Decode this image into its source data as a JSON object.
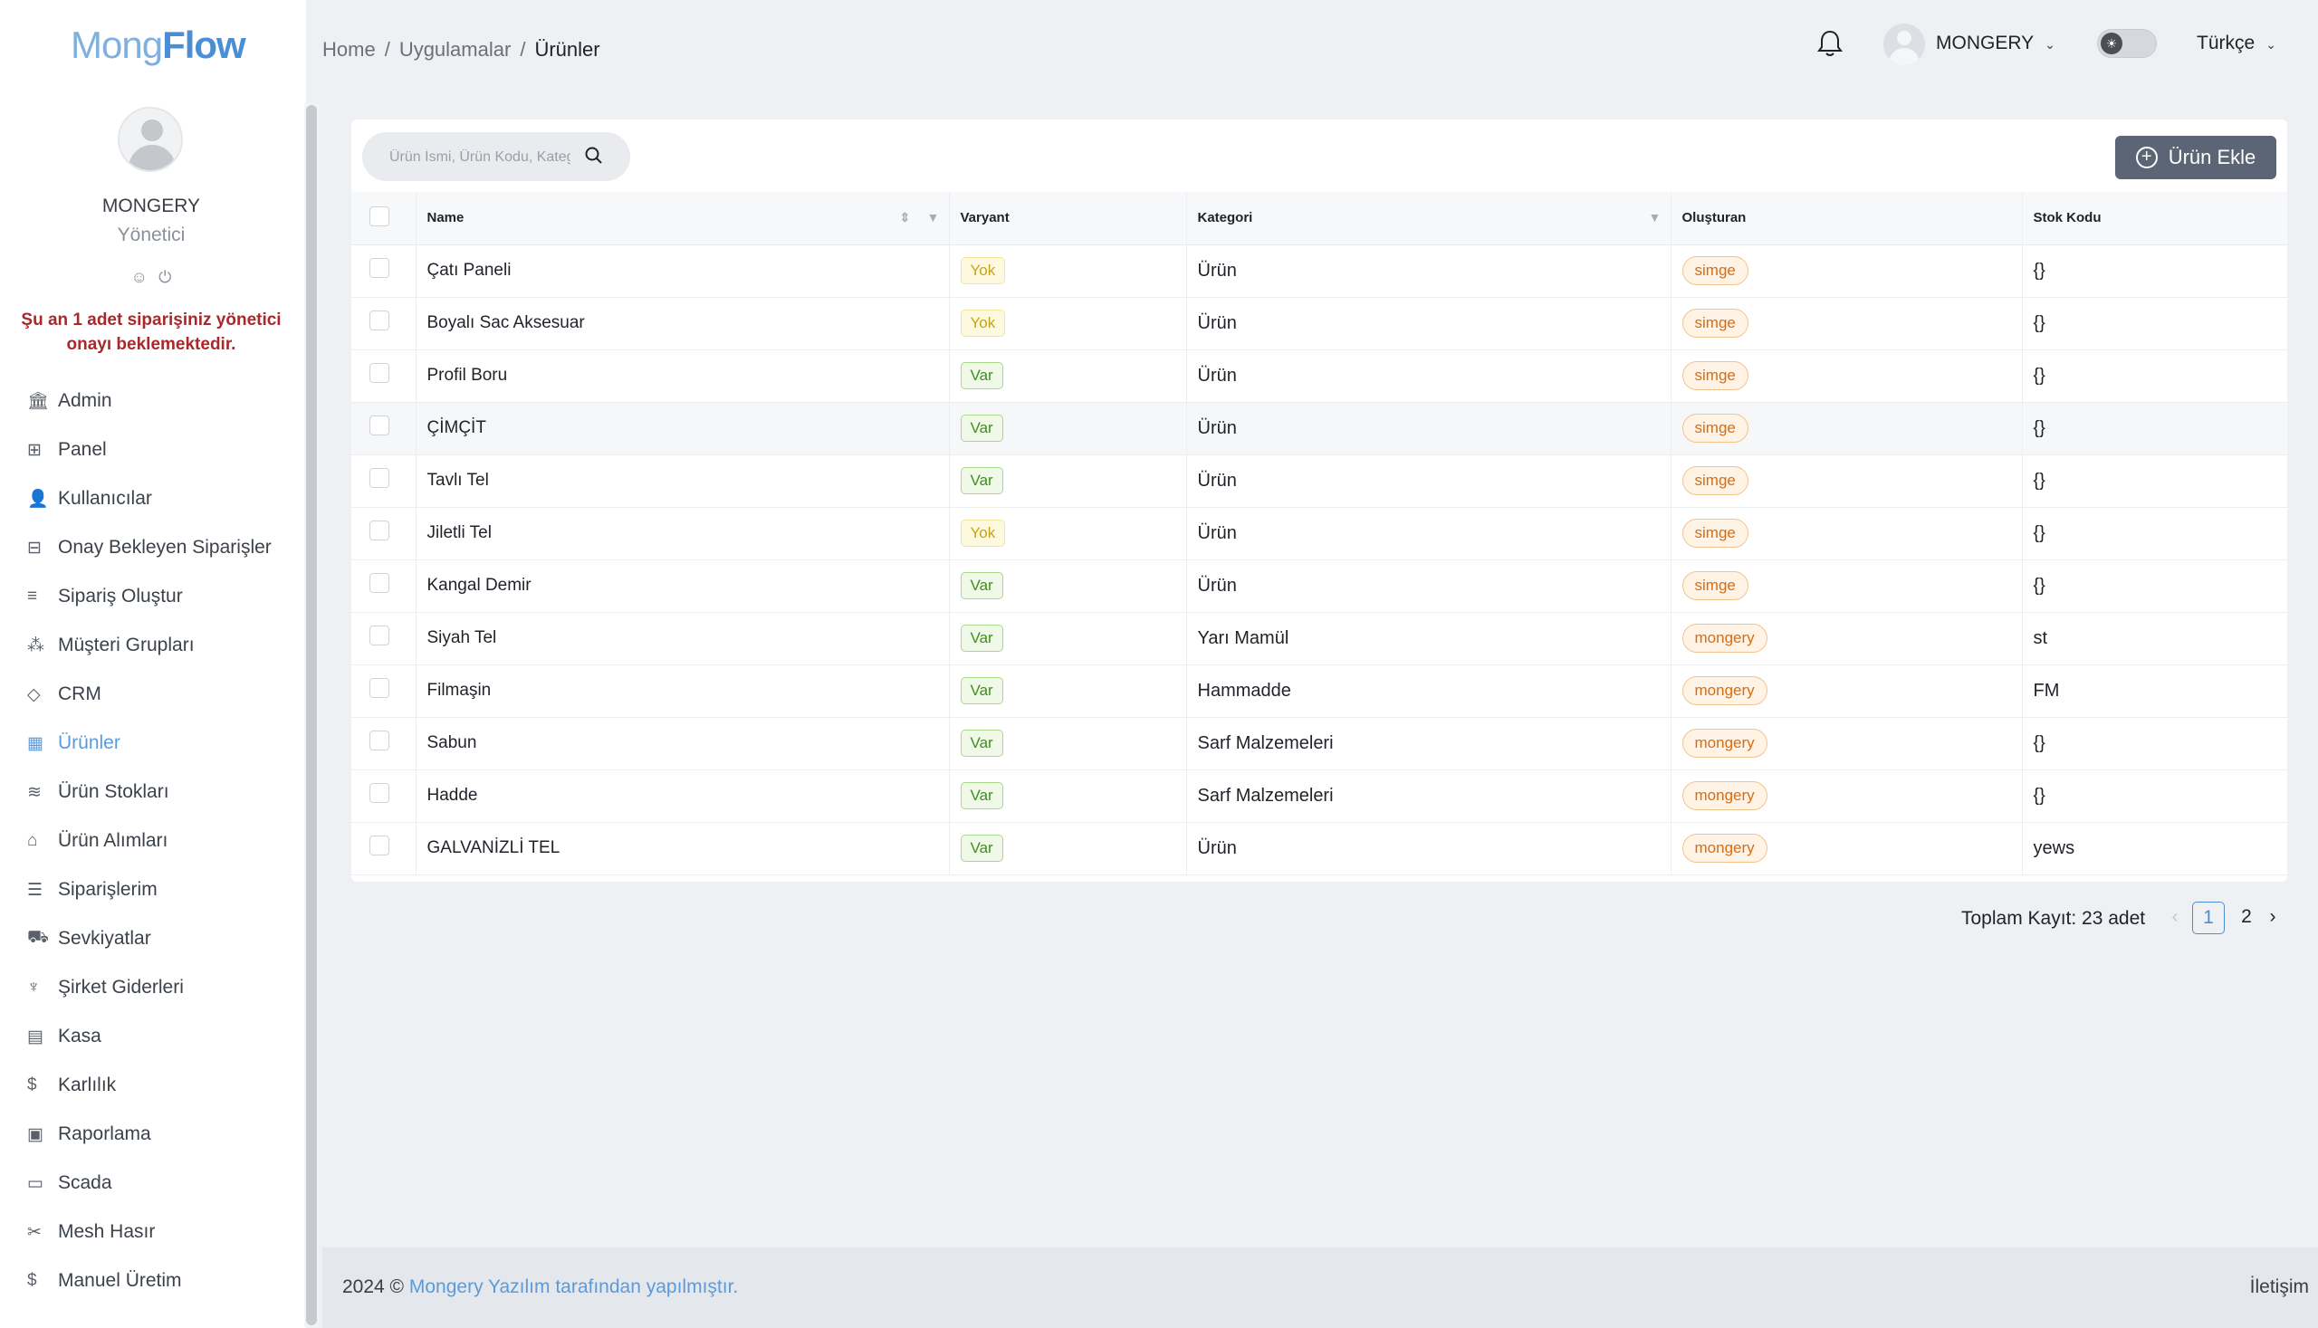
{
  "logo": {
    "part1": "Mong",
    "part2": "Flow"
  },
  "user": {
    "name": "MONGERY",
    "role": "Yönetici",
    "icons": [
      "user-icon",
      "power-icon"
    ]
  },
  "warning": "Şu an 1 adet siparişiniz yönetici onayı beklemektedir.",
  "menu": [
    {
      "label": "Admin",
      "icon": "bank-icon",
      "glyph": "🏛"
    },
    {
      "label": "Panel",
      "icon": "dashboard-icon",
      "glyph": "⊞"
    },
    {
      "label": "Kullanıcılar",
      "icon": "user-icon",
      "glyph": "👤"
    },
    {
      "label": "Onay Bekleyen Siparişler",
      "icon": "grid-icon",
      "glyph": "⊟"
    },
    {
      "label": "Sipariş Oluştur",
      "icon": "form-icon",
      "glyph": "≡"
    },
    {
      "label": "Müşteri Grupları",
      "icon": "cluster-icon",
      "glyph": "⁂"
    },
    {
      "label": "CRM",
      "icon": "diamond-icon",
      "glyph": "◇"
    },
    {
      "label": "Ürünler",
      "icon": "table-icon",
      "glyph": "▦",
      "active": true
    },
    {
      "label": "Ürün Stokları",
      "icon": "layers-icon",
      "glyph": "≋"
    },
    {
      "label": "Ürün Alımları",
      "icon": "basket-icon",
      "glyph": "⌂"
    },
    {
      "label": "Siparişlerim",
      "icon": "ordered-list-icon",
      "glyph": "☰"
    },
    {
      "label": "Sevkiyatlar",
      "icon": "truck-icon",
      "glyph": "⛟"
    },
    {
      "label": "Şirket Giderleri",
      "icon": "trophy-icon",
      "glyph": "♆"
    },
    {
      "label": "Kasa",
      "icon": "shop-icon",
      "glyph": "▤"
    },
    {
      "label": "Karlılık",
      "icon": "dollar-icon",
      "glyph": "$"
    },
    {
      "label": "Raporlama",
      "icon": "report-icon",
      "glyph": "▣"
    },
    {
      "label": "Scada",
      "icon": "tv-icon",
      "glyph": "▭"
    },
    {
      "label": "Mesh Hasır",
      "icon": "tool-icon",
      "glyph": "✂"
    },
    {
      "label": "Manuel Üretim",
      "icon": "dollar-icon",
      "glyph": "$"
    }
  ],
  "breadcrumb": [
    "Home",
    "Uygulamalar",
    "Ürünler"
  ],
  "header": {
    "user": "MONGERY",
    "language": "Türkçe"
  },
  "search": {
    "placeholder": "Ürün İsmi, Ürün Kodu, Kategori"
  },
  "add_button": "Ürün Ekle",
  "table": {
    "columns": [
      "Name",
      "Varyant",
      "Kategori",
      "Oluşturan",
      "Stok Kodu"
    ],
    "rows": [
      {
        "name": "Çatı Paneli",
        "variant": "Yok",
        "category": "Ürün",
        "creator": "simge",
        "stock": "{}"
      },
      {
        "name": "Boyalı Sac Aksesuar",
        "variant": "Yok",
        "category": "Ürün",
        "creator": "simge",
        "stock": "{}"
      },
      {
        "name": "Profil Boru",
        "variant": "Var",
        "category": "Ürün",
        "creator": "simge",
        "stock": "{}"
      },
      {
        "name": "ÇİMÇİT",
        "variant": "Var",
        "category": "Ürün",
        "creator": "simge",
        "stock": "{}"
      },
      {
        "name": "Tavlı Tel",
        "variant": "Var",
        "category": "Ürün",
        "creator": "simge",
        "stock": "{}"
      },
      {
        "name": "Jiletli Tel",
        "variant": "Yok",
        "category": "Ürün",
        "creator": "simge",
        "stock": "{}"
      },
      {
        "name": "Kangal Demir",
        "variant": "Var",
        "category": "Ürün",
        "creator": "simge",
        "stock": "{}"
      },
      {
        "name": "Siyah Tel",
        "variant": "Var",
        "category": "Yarı Mamül",
        "creator": "mongery",
        "stock": "st"
      },
      {
        "name": "Filmaşin",
        "variant": "Var",
        "category": "Hammadde",
        "creator": "mongery",
        "stock": "FM"
      },
      {
        "name": "Sabun",
        "variant": "Var",
        "category": "Sarf Malzemeleri",
        "creator": "mongery",
        "stock": "{}"
      },
      {
        "name": "Hadde",
        "variant": "Var",
        "category": "Sarf Malzemeleri",
        "creator": "mongery",
        "stock": "{}"
      },
      {
        "name": "GALVANİZLİ TEL",
        "variant": "Var",
        "category": "Ürün",
        "creator": "mongery",
        "stock": "yews"
      }
    ]
  },
  "pagination": {
    "total_text": "Toplam Kayıt: 23 adet",
    "pages": [
      "1",
      "2"
    ],
    "current": "1"
  },
  "footer": {
    "year": "2024 ©",
    "credit": "Mongery Yazılım tarafından yapılmıştır.",
    "contact": "İletişim"
  },
  "colors": {
    "accent": "#5b9bdc",
    "warning": "#a8282b",
    "button": "#5b6575"
  }
}
